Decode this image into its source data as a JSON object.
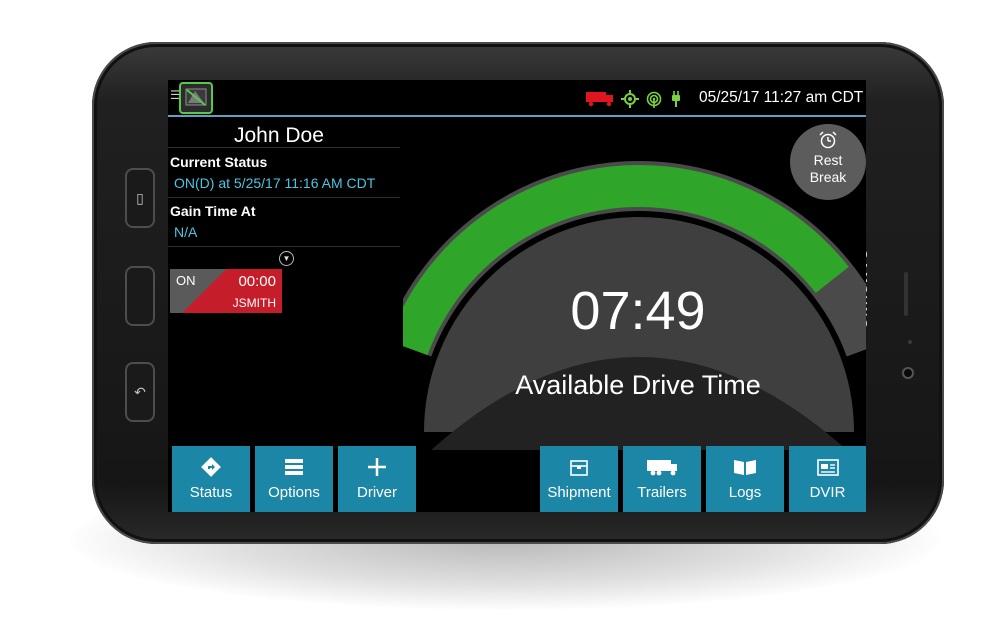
{
  "header": {
    "datetime": "05/25/17 11:27 am CDT"
  },
  "driver": {
    "name": "John Doe",
    "current_status_label": "Current Status",
    "current_status_value": "ON(D) at 5/25/17 11:16 AM CDT",
    "gain_time_label": "Gain Time At",
    "gain_time_value": "N/A"
  },
  "status_card": {
    "status": "ON",
    "time": "00:00",
    "user": "JSMITH"
  },
  "gauge": {
    "time": "07:49",
    "label": "Available Drive Time",
    "fill_fraction": 0.87
  },
  "rest_break": {
    "line1": "Rest",
    "line2": "Break"
  },
  "nav": {
    "status": "Status",
    "options": "Options",
    "driver": "Driver",
    "shipment": "Shipment",
    "trailers": "Trailers",
    "logs": "Logs",
    "dvir": "DVIR"
  },
  "device": {
    "brand": "SAMSUNG"
  },
  "colors": {
    "accent": "#1b86a6",
    "gauge_green": "#2fa52a",
    "status_red": "#c51d2a",
    "info_cyan": "#49c6e3"
  }
}
